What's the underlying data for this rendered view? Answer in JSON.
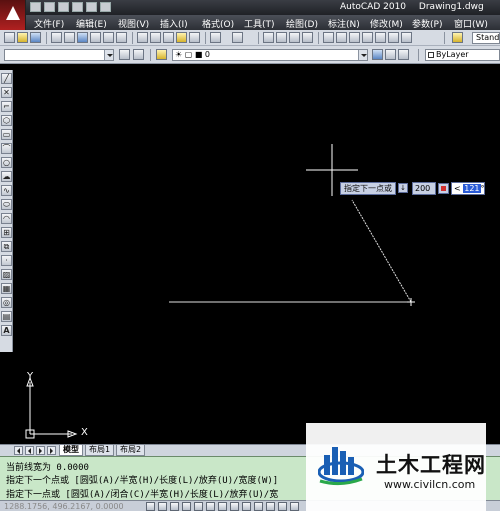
{
  "window": {
    "app_name": "AutoCAD 2010",
    "document": "Drawing1.dwg"
  },
  "menu": [
    {
      "label": "文件(F)"
    },
    {
      "label": "编辑(E)"
    },
    {
      "label": "视图(V)"
    },
    {
      "label": "插入(I)"
    },
    {
      "label": "格式(O)"
    },
    {
      "label": "工具(T)"
    },
    {
      "label": "绘图(D)"
    },
    {
      "label": "标注(N)"
    },
    {
      "label": "修改(M)"
    },
    {
      "label": "参数(P)"
    },
    {
      "label": "窗口(W)"
    }
  ],
  "toolbar": {
    "text_style": "Standa",
    "layer_current": "0",
    "color_current": "ByLayer"
  },
  "left_toolbar": {
    "text_tool": "A"
  },
  "dynamic_input": {
    "prompt": "指定下一点或",
    "length": "200",
    "angle_prefix": "<",
    "angle_value": "121",
    "angle_suffix": "°"
  },
  "ucs": {
    "x_label": "X",
    "y_label": "Y"
  },
  "layout_tabs": [
    {
      "label": "模型",
      "active": true
    },
    {
      "label": "布局1",
      "active": false
    },
    {
      "label": "布局2",
      "active": false
    }
  ],
  "command": {
    "line1": "当前线宽为 0.0000",
    "line2": "指定下一个点或 [圆弧(A)/半宽(H)/长度(L)/放弃(U)/宽度(W)]",
    "line3": "指定下一点或 [圆弧(A)/闭合(C)/半宽(H)/长度(L)/放弃(U)/宽"
  },
  "status": {
    "coords": "1288.1756, 496.2167, 0.0000"
  },
  "watermark": {
    "title": "土木工程网",
    "url": "www.civilcn.com"
  },
  "colors": {
    "canvas": "#000000",
    "command_bg": "#c9e7c8",
    "title_bg": "#2c2f35"
  }
}
